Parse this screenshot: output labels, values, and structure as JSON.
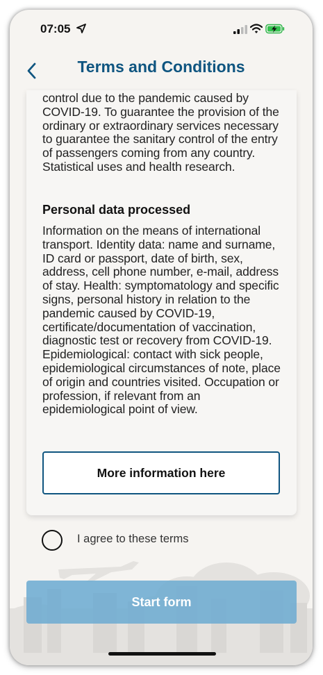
{
  "status_bar": {
    "time": "07:05",
    "icons": [
      "location-arrow-icon",
      "signal-icon",
      "wifi-icon",
      "battery-charging-icon"
    ]
  },
  "header": {
    "title": "Terms and Conditions",
    "back_icon": "chevron-left-icon"
  },
  "content": {
    "purpose_text": "control due to the pandemic caused by COVID-19. To guarantee the provision of the ordinary or extraordinary services necessary to guarantee the sanitary control of the entry of passengers coming from any country. Statistical uses and health research.",
    "personal_data_heading": "Personal data processed",
    "personal_data_text": "Information on the means of international transport. Identity data: name and surname, ID card or passport, date of birth, sex, address, cell phone number, e-mail, address of stay.  Health: symptomatology and specific signs, personal history in relation to the pandemic caused by COVID-19, certificate/documentation of vaccination, diagnostic test or recovery from COVID-19. Epidemiological: contact with sick people, epidemiological circumstances of note, place of origin and countries visited. Occupation or profession, if relevant from an epidemiological point of view.",
    "more_info_label": "More information here"
  },
  "agree": {
    "label": "I agree to these terms",
    "checked": false
  },
  "actions": {
    "start_label": "Start form"
  },
  "colors": {
    "accent": "#0f5580",
    "start_button": "#6eacd2",
    "background": "#f6f4f1"
  }
}
